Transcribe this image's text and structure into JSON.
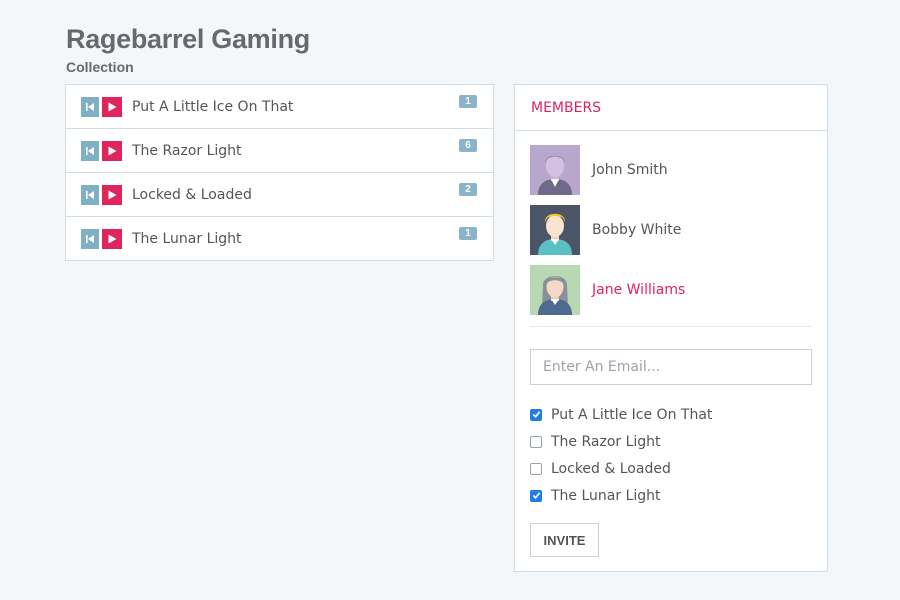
{
  "header": {
    "title": "Ragebarrel Gaming",
    "subtitle": "Collection"
  },
  "collection": {
    "tracks": [
      {
        "name": "Put A Little Ice On That",
        "count": "1"
      },
      {
        "name": "The Razor Light",
        "count": "6"
      },
      {
        "name": "Locked & Loaded",
        "count": "2"
      },
      {
        "name": "The Lunar Light",
        "count": "1"
      }
    ]
  },
  "members": {
    "heading": "MEMBERS",
    "list": [
      {
        "name": "John Smith",
        "avatar": "avatar-purple-icon"
      },
      {
        "name": "Bobby White",
        "avatar": "avatar-blonde-icon"
      },
      {
        "name": "Jane Williams",
        "avatar": "avatar-woman-icon"
      }
    ],
    "email_placeholder": "Enter An Email...",
    "checklist": [
      {
        "label": "Put A Little Ice On That",
        "checked": true
      },
      {
        "label": "The Razor Light",
        "checked": false
      },
      {
        "label": "Locked & Loaded",
        "checked": false
      },
      {
        "label": "The Lunar Light",
        "checked": true
      }
    ],
    "invite_label": "INVITE"
  },
  "colors": {
    "accent": "#e0245e",
    "secondary": "#7fb0c6",
    "badge": "#8bb3c9",
    "checkbox": "#1f7fe0"
  }
}
